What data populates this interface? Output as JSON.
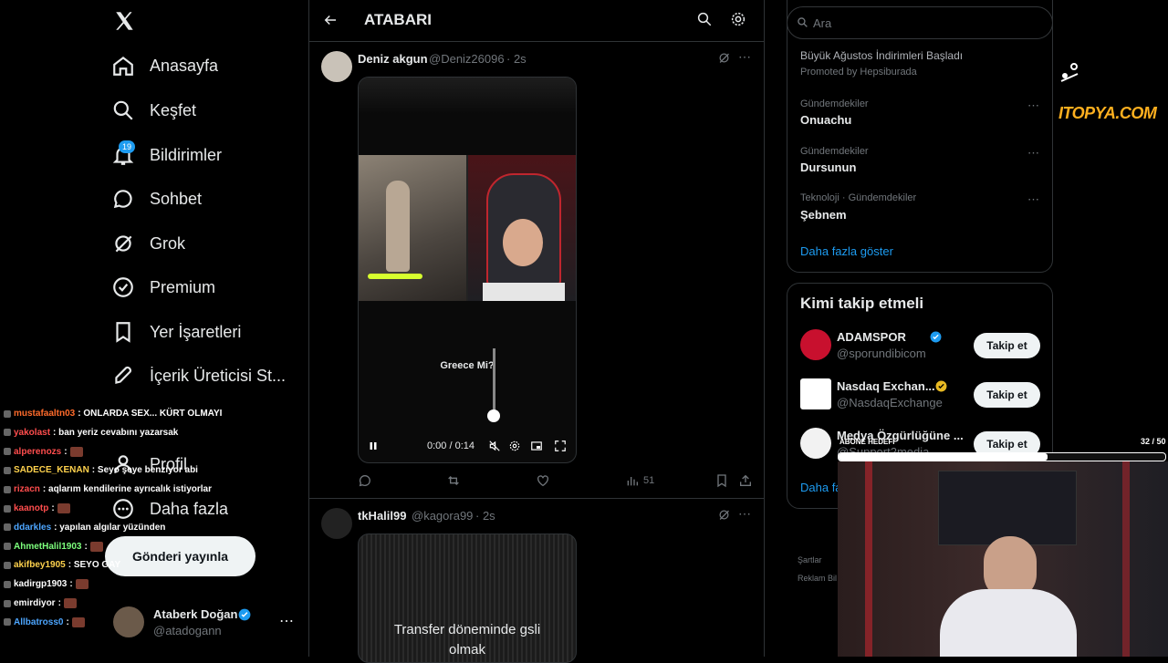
{
  "nav": {
    "items": [
      {
        "label": "Anasayfa"
      },
      {
        "label": "Keşfet"
      },
      {
        "label": "Bildirimler",
        "badge": "19"
      },
      {
        "label": "Sohbet"
      },
      {
        "label": "Grok"
      },
      {
        "label": "Premium"
      },
      {
        "label": "Yer İşaretleri"
      },
      {
        "label": "İçerik Üreticisi St..."
      },
      {
        "label": "Profil"
      },
      {
        "label": "Daha fazla"
      }
    ],
    "post_button": "Gönderi yayınla",
    "profile": {
      "name": "Ataberk Doğan",
      "handle": "@atadogann"
    }
  },
  "chat": [
    {
      "user": "mustafaaltn03",
      "msg": ": ONLARDA SEX... KÜRT OLMAYI",
      "color": "#ff6b2b"
    },
    {
      "user": "yakolast",
      "msg": ": ban yeriz cevabını yazarsak",
      "color": "#ff4d4d"
    },
    {
      "user": "alperenozs",
      "msg": ":",
      "color": "#ff4d4d"
    },
    {
      "user": "SADECE_KENAN",
      "msg": ": Seyo şeye benziyor abi",
      "color": "#ffd24d"
    },
    {
      "user": "rizacn",
      "msg": ": aqlarım kendilerine ayrıcalık istiyorlar",
      "color": "#ff4d4d"
    },
    {
      "user": "kaanotp",
      "msg": ":",
      "color": "#ff4d4d"
    },
    {
      "user": "ddarkles",
      "msg": ": yapılan algılar yüzünden",
      "color": "#4da6ff"
    },
    {
      "user": "AhmetHalil1903",
      "msg": ":",
      "color": "#7dff7d"
    },
    {
      "user": "akifbey1905",
      "msg": ": SEYO GAY",
      "color": "#ffd24d"
    },
    {
      "user": "kadirgp1903",
      "msg": ":",
      "color": "#ffffff"
    },
    {
      "user": "emirdiyor",
      "msg": ":",
      "color": "#ffffff"
    },
    {
      "user": "Allbatross0",
      "msg": ":",
      "color": "#4da6ff"
    }
  ],
  "header": {
    "title": "ATABARI"
  },
  "tweets": [
    {
      "name": "Deniz akgun",
      "handle": "@Deniz26096",
      "time": "· 2s",
      "video_caption": "Greece Mi?",
      "video_time": "0:00 / 0:14",
      "views": "51"
    },
    {
      "name": "tkHalil99",
      "handle": "@kagora99",
      "time": "· 2s",
      "media_text": "Transfer döneminde gsli olmak"
    }
  ],
  "right": {
    "search_placeholder": "Ara",
    "promo_title": "Büyük Ağustos İndirimleri Başladı",
    "promo_by": "Promoted by Hepsiburada",
    "trends": [
      {
        "category": "Gündemdekiler",
        "name": "Onuachu"
      },
      {
        "category": "Gündemdekiler",
        "name": "Dursunun"
      },
      {
        "category": "Teknoloji · Gündemdekiler",
        "name": "Şebnem"
      }
    ],
    "show_more": "Daha fazla göster",
    "who_to_follow_title": "Kimi takip etmeli",
    "follow_button": "Takip et",
    "suggestions": [
      {
        "name": "ADAMSPOR",
        "handle": "@sporundibicom"
      },
      {
        "name": "Nasdaq Exchan...",
        "handle": "@NasdaqExchange"
      },
      {
        "name": "Medya Özgürlüğüne ...",
        "handle": "@Support2media"
      }
    ],
    "show_more_short": "Daha fa",
    "footer_terms": "Şartlar",
    "footer_ads": "Reklam Bil"
  },
  "overlay": {
    "logo_text": "ITOPYA.COM",
    "sub_goal_label": "ABONE HEDEFİ",
    "sub_goal_count": "32 / 50",
    "sub_goal_progress": 0.64
  },
  "colors": {
    "accent": "#1d9bf0",
    "background": "#000000",
    "gold": "#ffb01f"
  }
}
